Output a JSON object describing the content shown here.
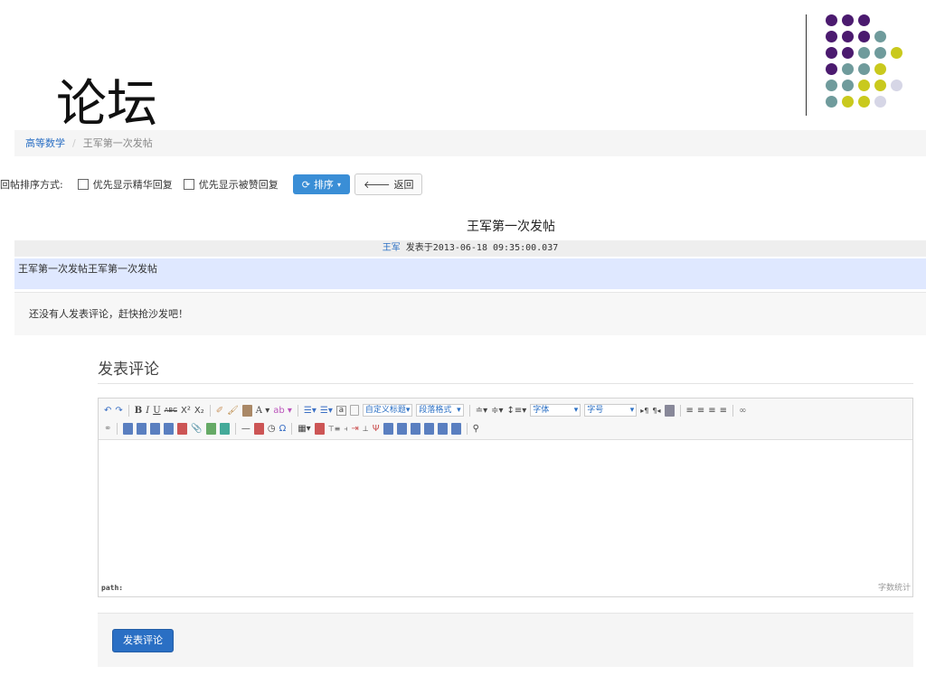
{
  "header": {
    "title": "论坛",
    "logo_colors": [
      "#4b1a6f",
      "#6f9b9c",
      "#c9c91d",
      "#d6d6e6"
    ]
  },
  "breadcrumb": {
    "course": "高等数学",
    "current": "王军第一次发帖"
  },
  "sort": {
    "label": "回帖排序方式:",
    "option1": "优先显示精华回复",
    "option2": "优先显示被赞回复",
    "sort_button": "排序",
    "back_button": "返回"
  },
  "post": {
    "title": "王军第一次发帖",
    "author": "王军",
    "posted_prefix": "发表于",
    "timestamp": "2013-06-18 09:35:00.037",
    "content": "王军第一次发帖王军第一次发帖",
    "no_comments": "还没有人发表评论，赶快抢沙发吧！"
  },
  "comment": {
    "heading": "发表评论",
    "custom_title_select": "自定义标题",
    "paragraph_format_select": "段落格式",
    "font_select": "字体",
    "font_size_select": "字号",
    "path_label": "path:",
    "word_count": "字数统计",
    "submit_button": "发表评论"
  }
}
